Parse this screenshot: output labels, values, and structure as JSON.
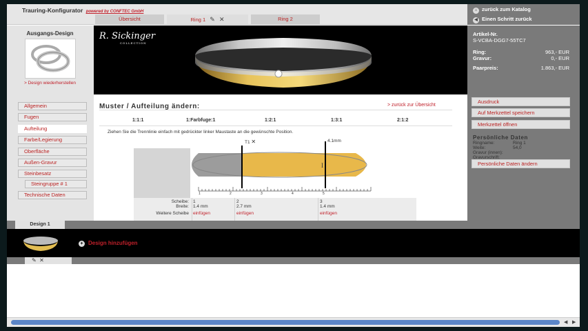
{
  "header": {
    "title": "Trauring-Konfigurator",
    "powered": "powered by CONFTEC GmbH",
    "tabs": [
      {
        "label": "Übersicht"
      },
      {
        "label": "Ring 1",
        "icons": [
          "pencil-icon",
          "close-icon"
        ]
      },
      {
        "label": "Ring 2"
      }
    ],
    "catalog_link": "zurück zum Katalog",
    "step_back": "Einen Schritt zurück"
  },
  "left": {
    "origin_title": "Ausgangs-Design",
    "restore": "> Design wiederherstellen",
    "menu": [
      "Allgemein",
      "Fugen",
      "Aufteilung",
      "Farbe/Legierung",
      "Oberfläche",
      "Außen-Gravur",
      "Steinbesatz",
      "Steingruppe # 1",
      "Technische Daten"
    ]
  },
  "hero": {
    "brand": "R. Sickinger",
    "brand_sub": "COLLECTION"
  },
  "article": {
    "label": "Artikel-Nr.",
    "number": "S-VCBA-DGG7-55TC7",
    "prices": [
      {
        "label": "Ring:",
        "value": "963,- EUR"
      },
      {
        "label": "Gravur:",
        "value": "0,- EUR"
      },
      {
        "label": "Paarpreis:",
        "value": "1.863,- EUR"
      }
    ]
  },
  "content": {
    "title": "Muster / Aufteilung ändern:",
    "back": "> zurück zur Übersicht",
    "ratios": [
      "1:1:1",
      "1:Farbfuge:1",
      "1:2:1",
      "1:3:1",
      "2:1:2"
    ],
    "instruction": "Ziehen Sie die Trennlinie einfach mit gedrückter linker Maustaste an die gewünschte Position.",
    "handle_label": "T1",
    "width_label": "4.1mm",
    "ruler": [
      "1",
      "2",
      "3",
      "4",
      "5"
    ],
    "scheibe_label": "Scheibe:",
    "breite_label": "Breite:",
    "weitere_label": "Weitere Scheibe",
    "slices": [
      {
        "n": "1",
        "w": "1.4 mm",
        "act": "einfügen"
      },
      {
        "n": "2",
        "w": "2.7 mm",
        "act": "einfügen"
      },
      {
        "n": "3",
        "w": "1.4 mm",
        "act": "einfügen"
      }
    ]
  },
  "right": {
    "buttons": [
      "Ausdruck",
      "Auf Merkzettel speichern",
      "Merkzettel öffnen"
    ],
    "personal_title": "Persönliche Daten",
    "personal": [
      {
        "label": "Ringname:",
        "value": "Ring 1"
      },
      {
        "label": "Weite:",
        "value": "54,0"
      },
      {
        "label": "Gravur (innen):",
        "value": ""
      },
      {
        "label": "Gravurschrift:",
        "value": ""
      }
    ],
    "personal_btn": "Persönliche Daten ändern"
  },
  "design": {
    "tab": "Design 1",
    "add": "Design hinzufügen"
  },
  "colors": {
    "gold": "#e8b84a",
    "silver": "#9c9c9c",
    "accent": "#c0202a"
  }
}
